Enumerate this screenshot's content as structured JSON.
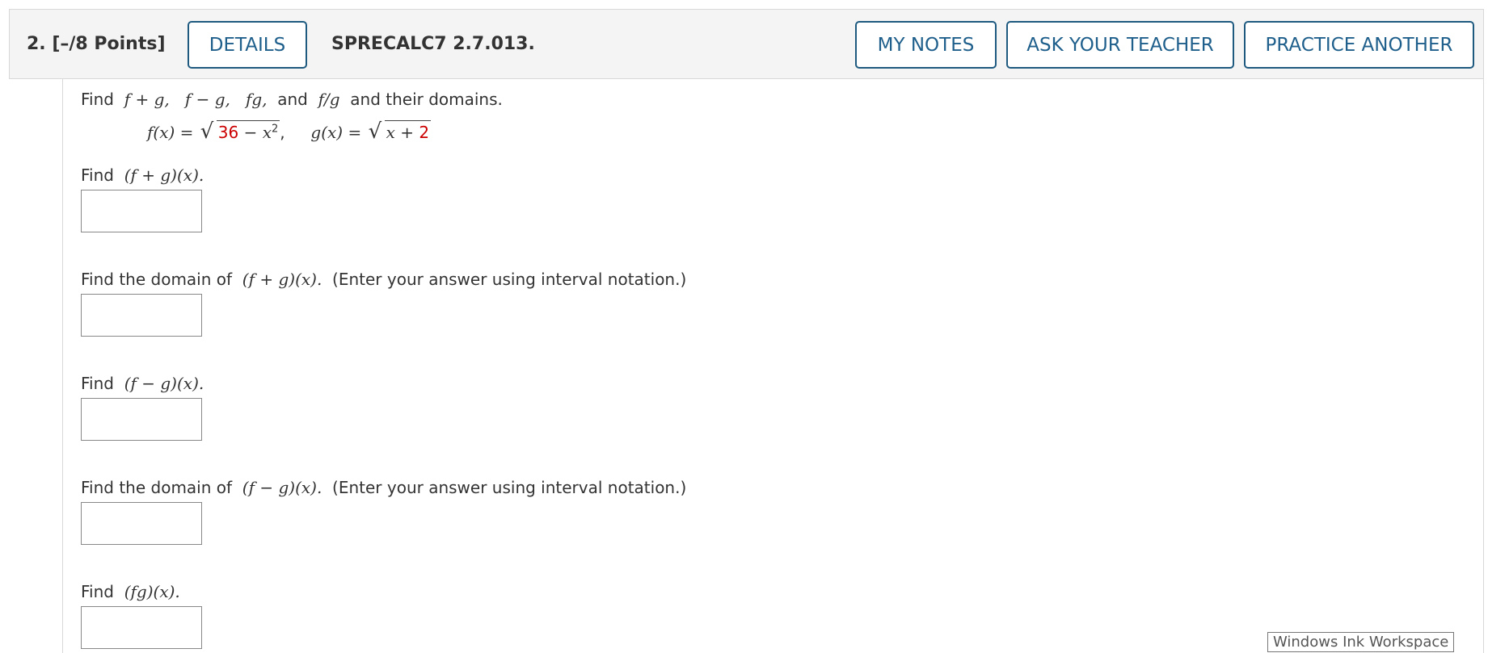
{
  "header": {
    "question_number": "2.",
    "points": "[–/8 Points]",
    "details_label": "DETAILS",
    "question_id": "SPRECALC7 2.7.013.",
    "my_notes_label": "MY NOTES",
    "ask_teacher_label": "ASK YOUR TEACHER",
    "practice_another_label": "PRACTICE ANOTHER"
  },
  "problem": {
    "intro_find": "Find",
    "intro_f_plus_g": "f + g,",
    "intro_f_minus_g": "f − g,",
    "intro_fg": "fg,",
    "intro_and": "and",
    "intro_f_over_g": "f/g",
    "intro_tail": "and their domains.",
    "f_lhs": "f(x) =",
    "f_radicand_red": "36",
    "f_radicand_rest": " − x",
    "f_exponent": "2",
    "f_trailing": ",",
    "g_lhs": "g(x) =",
    "g_radicand_rest": "x + ",
    "g_radicand_red": "2"
  },
  "parts": [
    {
      "prefix": "Find",
      "expr": "(f + g)(x).",
      "note": ""
    },
    {
      "prefix": "Find the domain of",
      "expr": "(f + g)(x).",
      "note": "(Enter your answer using interval notation.)"
    },
    {
      "prefix": "Find",
      "expr": "(f − g)(x).",
      "note": ""
    },
    {
      "prefix": "Find the domain of",
      "expr": "(f − g)(x).",
      "note": "(Enter your answer using interval notation.)"
    },
    {
      "prefix": "Find",
      "expr": "(fg)(x).",
      "note": ""
    }
  ],
  "tooltip": "Windows Ink Workspace",
  "colors": {
    "button_text": "#1f5f8c",
    "button_border": "#1e5a80",
    "highlight": "#cc0000",
    "header_bg": "#f4f4f4"
  }
}
